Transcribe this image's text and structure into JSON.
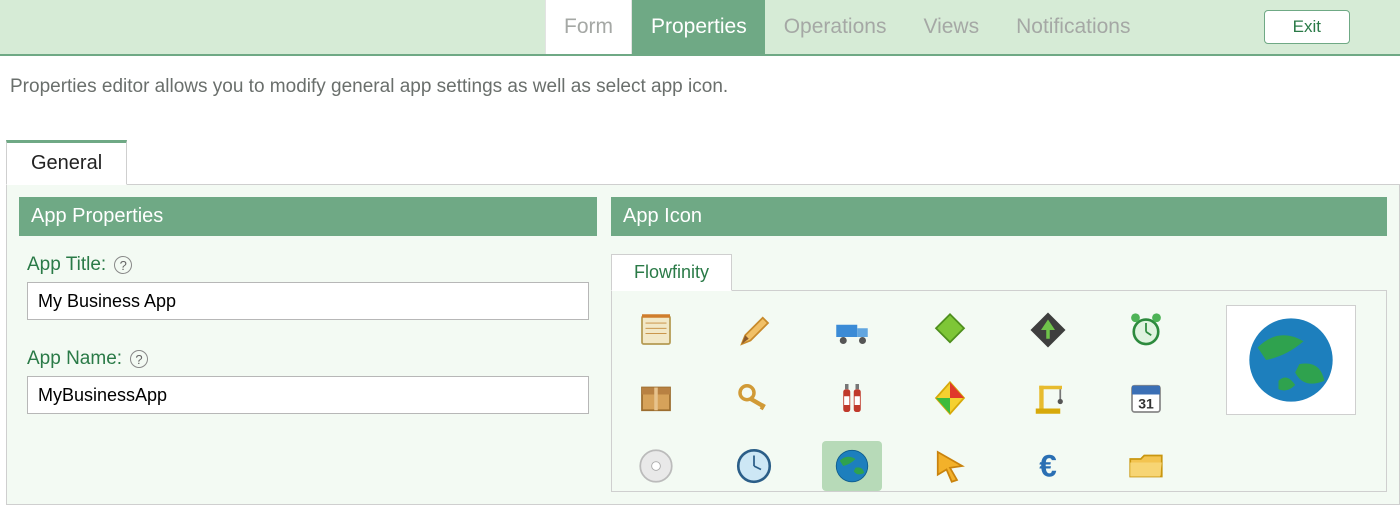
{
  "nav": {
    "tabs": [
      "Form",
      "Properties",
      "Operations",
      "Views",
      "Notifications"
    ],
    "active": "Properties",
    "exit_label": "Exit"
  },
  "description": "Properties editor allows you to modify general app settings as well as select app icon.",
  "tabs": {
    "general": "General"
  },
  "sections": {
    "app_properties": "App Properties",
    "app_icon": "App Icon"
  },
  "fields": {
    "app_title_label": "App Title:",
    "app_title_value": "My Business App",
    "app_name_label": "App Name:",
    "app_name_value": "MyBusinessApp"
  },
  "icon_picker": {
    "tab_label": "Flowfinity",
    "selected_icon": "globe-icon",
    "icons": [
      "notepad-icon",
      "pencil-icon",
      "truck-icon",
      "highlighter-icon",
      "up-arrow-diamond-icon",
      "alarm-clock-icon",
      "package-icon",
      "keys-icon",
      "ketchup-icon",
      "kite-icon",
      "crane-icon",
      "calendar-31-icon",
      "cd-icon",
      "clock-icon",
      "globe-icon",
      "cursor-arrow-icon",
      "euro-icon",
      "folder-icon"
    ]
  }
}
